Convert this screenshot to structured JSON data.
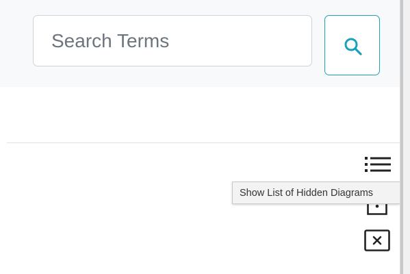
{
  "search": {
    "placeholder": "Search Terms",
    "value": "",
    "button_icon": "search-icon"
  },
  "toolbar": {
    "icons": [
      "list-icon",
      "box-dot-icon",
      "box-x-icon"
    ]
  },
  "tooltip": {
    "text": "Show List of Hidden Diagrams"
  },
  "colors": {
    "accent": "#17a2b8",
    "band_background": "#f7f9fb",
    "icon": "#222222"
  }
}
